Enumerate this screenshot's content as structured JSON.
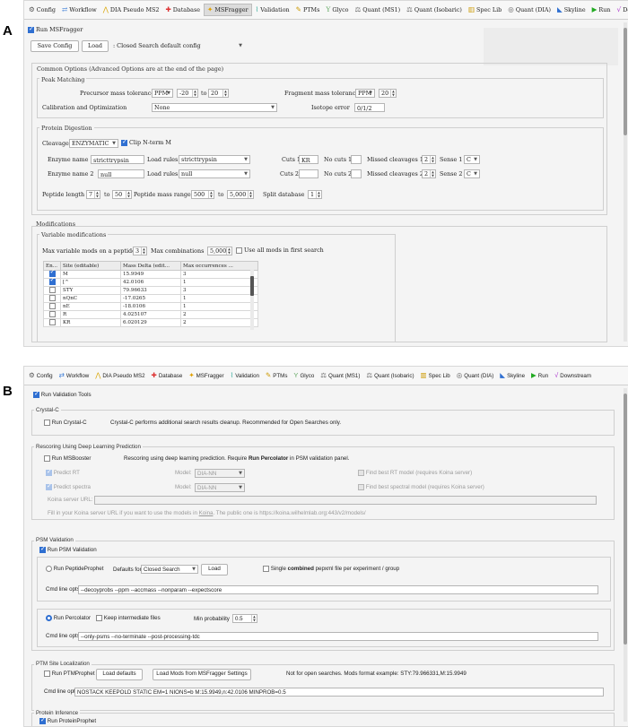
{
  "panels": {
    "a": "A",
    "b": "B"
  },
  "tabs_a": [
    {
      "icon": "⚙",
      "label": "Config"
    },
    {
      "icon": "⇄",
      "label": "Workflow"
    },
    {
      "icon": "⋀",
      "label": "DIA Pseudo MS2"
    },
    {
      "icon": "✚",
      "label": "Database"
    },
    {
      "icon": "✦",
      "label": "MSFragger"
    },
    {
      "icon": "⌇",
      "label": "Validation"
    },
    {
      "icon": "✎",
      "label": "PTMs"
    },
    {
      "icon": "Y",
      "label": "Glyco"
    },
    {
      "icon": "⚖",
      "label": "Quant (MS1)"
    },
    {
      "icon": "⚖",
      "label": "Quant (Isobaric)"
    },
    {
      "icon": "▥",
      "label": "Spec Lib"
    },
    {
      "icon": "◎",
      "label": "Quant (DIA)"
    },
    {
      "icon": "◣",
      "label": "Skyline"
    },
    {
      "icon": "▶",
      "label": "Run"
    },
    {
      "icon": "√",
      "label": "Downstream"
    }
  ],
  "tabs_b": [
    {
      "icon": "⚙",
      "label": "Config"
    },
    {
      "icon": "⇄",
      "label": "Workflow"
    },
    {
      "icon": "⋀",
      "label": "DIA Pseudo MS2"
    },
    {
      "icon": "✚",
      "label": "Database"
    },
    {
      "icon": "✦",
      "label": "MSFragger"
    },
    {
      "icon": "⌇",
      "label": "Validation"
    },
    {
      "icon": "✎",
      "label": "PTMs"
    },
    {
      "icon": "Y",
      "label": "Glyco"
    },
    {
      "icon": "⚖",
      "label": "Quant (MS1)"
    },
    {
      "icon": "⚖",
      "label": "Quant (Isobaric)"
    },
    {
      "icon": "▥",
      "label": "Spec Lib"
    },
    {
      "icon": "◎",
      "label": "Quant (DIA)"
    },
    {
      "icon": "◣",
      "label": "Skyline"
    },
    {
      "icon": "▶",
      "label": "Run"
    },
    {
      "icon": "√",
      "label": "Downstream"
    }
  ],
  "a": {
    "run_msfragger": "Run MSFragger",
    "save_config": "Save Config",
    "load": "Load",
    "config_select": ": Closed Search default config",
    "common_options": "Common Options (Advanced Options are at the end of the page)",
    "peak_matching": "Peak Matching",
    "precursor_tol": "Precursor mass tolerance",
    "ppm": "PPM",
    "prec_low": "-20",
    "to": "to",
    "prec_high": "20",
    "fragment_tol": "Fragment mass tolerance",
    "frag_unit": "PPM",
    "frag_val": "20",
    "calibration": "Calibration and Optimization",
    "calib_val": "None",
    "isotope_error": "Isotope error",
    "isotope_val": "0/1/2",
    "protein_digestion": "Protein Digestion",
    "cleavage": "Cleavage",
    "cleavage_val": "ENZYMATIC",
    "clip_nterm": "Clip N-term M",
    "enzyme1": "Enzyme name 1",
    "enzyme1_val": "stricttrypsin",
    "load_rules": "Load rules",
    "load_rules1_val": "stricttrypsin",
    "cuts1": "Cuts 1",
    "cuts1_val": "KR",
    "nocuts1": "No cuts 1",
    "missed1": "Missed cleavages 1",
    "missed1_val": "2",
    "sense1": "Sense 1",
    "sense1_val": "C",
    "enzyme2": "Enzyme name 2",
    "enzyme2_val": "null",
    "load_rules2_val": "null",
    "cuts2": "Cuts 2",
    "nocuts2": "No cuts 2",
    "missed2": "Missed cleavages 2",
    "missed2_val": "2",
    "sense2": "Sense 2",
    "sense2_val": "C",
    "pep_length": "Peptide length",
    "pep_len_low": "7",
    "pep_len_high": "50",
    "pep_mass": "Peptide mass range",
    "pep_mass_low": "500",
    "pep_mass_high": "5,000",
    "split_db": "Split database",
    "split_val": "1",
    "modifications": "Modifications",
    "variable_mods": "Variable modifications",
    "max_var_mods": "Max variable mods on a peptide",
    "max_var_val": "3",
    "max_comb": "Max combinations",
    "max_comb_val": "5,000",
    "use_all_mods": "Use all mods in first search",
    "table_headers": [
      "En...",
      "Site (editable)",
      "Mass Delta (edit...",
      "Max occurrences ..."
    ],
    "table_rows": [
      {
        "site": "M",
        "delta": "15.9949",
        "max": "3"
      },
      {
        "site": "[^",
        "delta": "42.0106",
        "max": "1"
      },
      {
        "site": "STY",
        "delta": "79.96633",
        "max": "3"
      },
      {
        "site": "nQnC",
        "delta": "-17.0265",
        "max": "1"
      },
      {
        "site": "nE",
        "delta": "-18.0106",
        "max": "1"
      },
      {
        "site": "R",
        "delta": "4.025107",
        "max": "2"
      },
      {
        "site": "KR",
        "delta": "6.020129",
        "max": "2"
      }
    ]
  },
  "b": {
    "run_validation": "Run Validation Tools",
    "crystalc": "Crystal-C",
    "run_crystalc": "Run Crystal-C",
    "crystalc_desc": "Crystal-C performs additional search results cleanup. Recommended for Open Searches only.",
    "rescoring": "Rescoring Using Deep Learning Prediction",
    "run_msbooster": "Run MSBooster",
    "msbooster_desc_a": "Rescoring using deep learning prediction. Require ",
    "msbooster_desc_b": "Run Percolator",
    "msbooster_desc_c": " in PSM validation panel.",
    "predict_rt": "Predict RT",
    "model": "Model:",
    "model_rt": "DIA-NN",
    "find_rt": "Find best RT model (requires Koina server)",
    "predict_spectra": "Predict spectra",
    "model_spec": "DIA-NN",
    "find_spec": "Find best spectral model (requires Koina server)",
    "koina": "Koina server URL:",
    "koina_hint_a": "Fill in your Koina server URL if you want to use the models in ",
    "koina_hint_link": "Koina",
    "koina_hint_b": ". The public one is https://koina.wilhelmlab.org:443/v2/models/",
    "psm_validation": "PSM Validation",
    "run_psm": "Run PSM Validation",
    "run_peptideprophet": "Run PeptideProphet",
    "defaults_for": "Defaults for:",
    "defaults_val": "Closed Search",
    "load": "Load",
    "single_a": "Single ",
    "single_b": "combined",
    "single_c": " pepxml file per experiment / group",
    "cmd_label": "Cmd line opts:",
    "pp_cmd": "--decoyprobs --ppm --accmass --nonparam --expectscore",
    "run_percolator": "Run Percolator",
    "keep_files": "Keep intermediate files",
    "min_prob": "Min probability",
    "min_prob_val": "0.5",
    "perc_cmd": "--only-psms --no-terminate --post-processing-tdc",
    "ptm_site": "PTM Site Localization",
    "run_ptmprophet": "Run PTMProphet",
    "load_defaults": "Load defaults",
    "load_mods": "Load Mods from MSFragger Settings",
    "ptm_note": "Not for open searches. Mods format example: STY:79.966331,M:15.9949",
    "ptm_cmd_label": "Cmd line opts",
    "ptm_cmd": "NOSTACK KEEPOLD STATIC EM=1 NIONS=b M:15.9949,n:42.0106 MINPROB=0.5",
    "protein_inference": "Protein Inference",
    "run_proteinprophet": "Run ProteinProphet"
  }
}
